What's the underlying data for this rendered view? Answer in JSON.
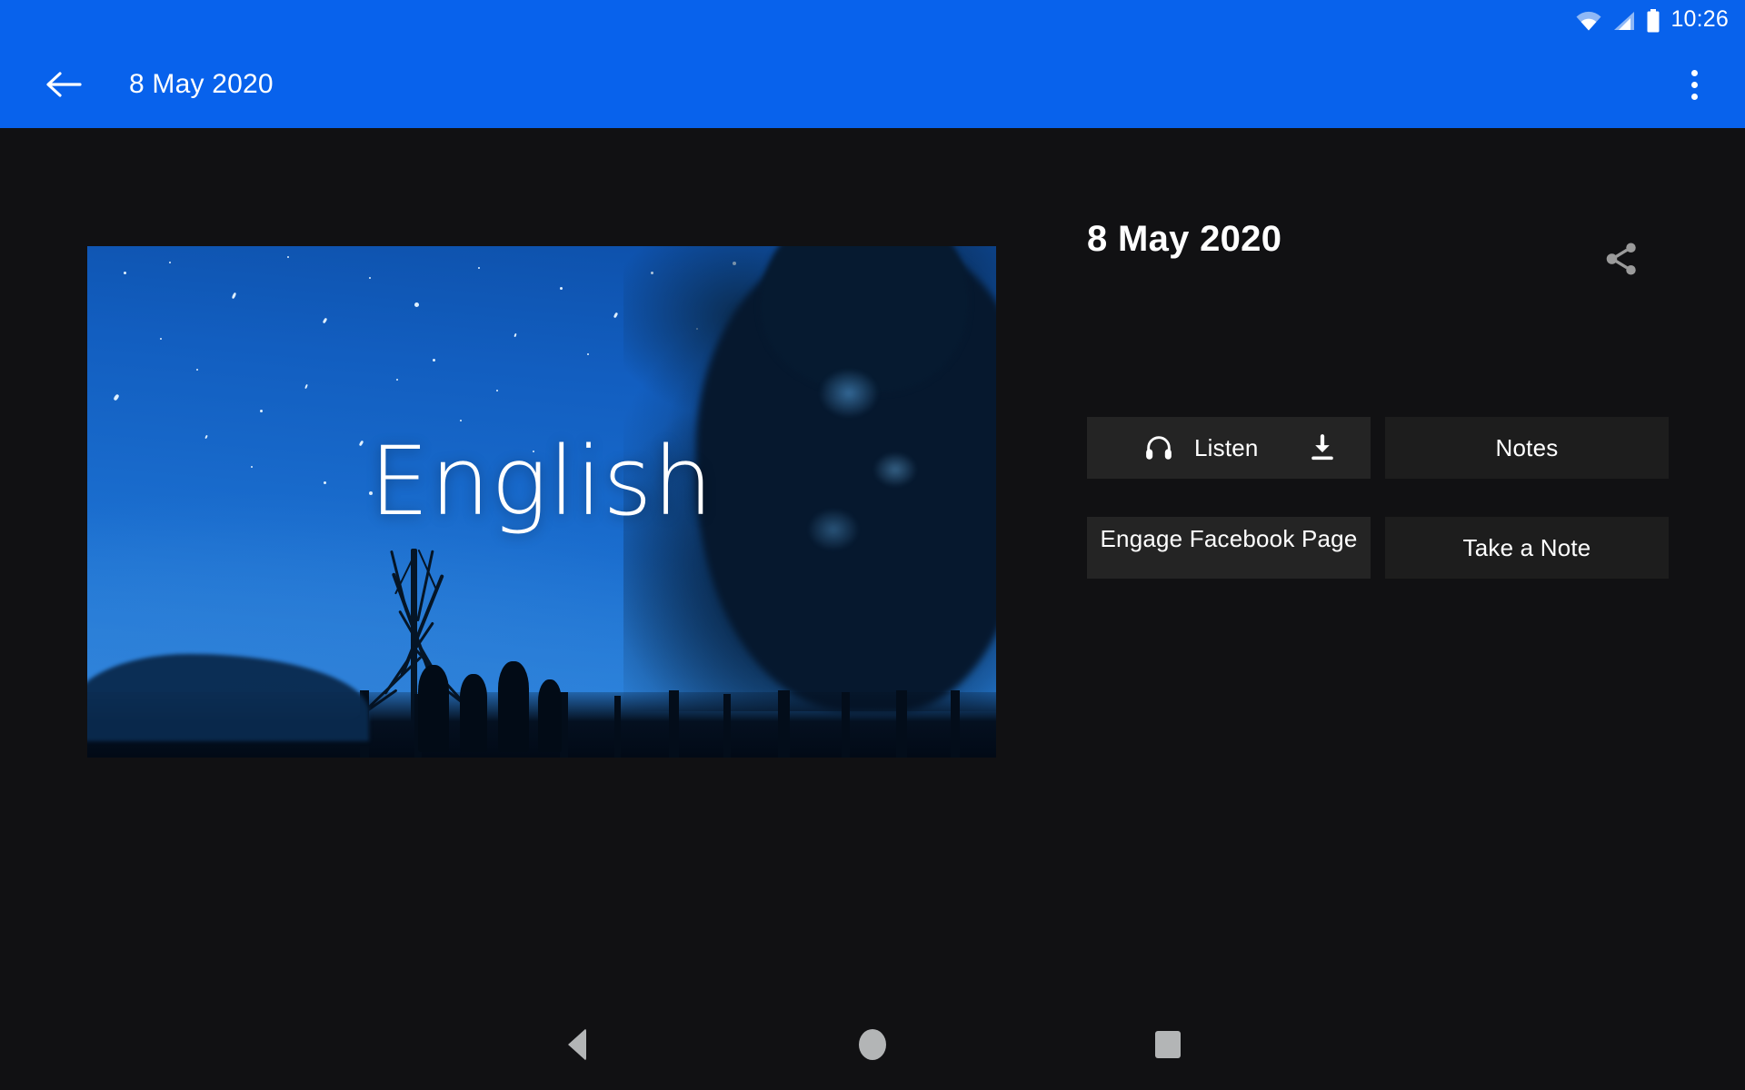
{
  "status_bar": {
    "time": "10:26",
    "icons": [
      "wifi-icon",
      "cellular-signal-icon",
      "battery-icon"
    ],
    "background_color": "#0862ec"
  },
  "app_bar": {
    "back_icon": "back-arrow-icon",
    "title": "8 May 2020",
    "overflow_icon": "overflow-menu-icon",
    "background_color": "#0862ec",
    "text_color": "#ffffff"
  },
  "media": {
    "caption": "English",
    "description": "Night sky with stars, tree silhouettes and people",
    "sky_color": "#1a6dce"
  },
  "panel": {
    "title": "8 May 2020",
    "share_icon": "share-icon",
    "buttons": [
      {
        "label": "Listen",
        "icon": "headphones-icon",
        "trailing_icon": "download-icon",
        "style": "dark"
      },
      {
        "label": "Notes",
        "icon": null,
        "trailing_icon": null,
        "style": "darker"
      },
      {
        "label": "Engage Facebook Page",
        "icon": null,
        "trailing_icon": null,
        "style": "dark"
      },
      {
        "label": "Take a Note",
        "icon": null,
        "trailing_icon": null,
        "style": "darker"
      }
    ]
  },
  "nav_bar": {
    "back_label": "Back",
    "home_label": "Home",
    "recents_label": "Recents",
    "icon_color": "#b3b5b6"
  },
  "theme": {
    "accent": "#0862ec",
    "background": "#111113",
    "button_bg": "#242424",
    "button_bg_alt": "#1d1d1d",
    "text": "#ffffff"
  }
}
